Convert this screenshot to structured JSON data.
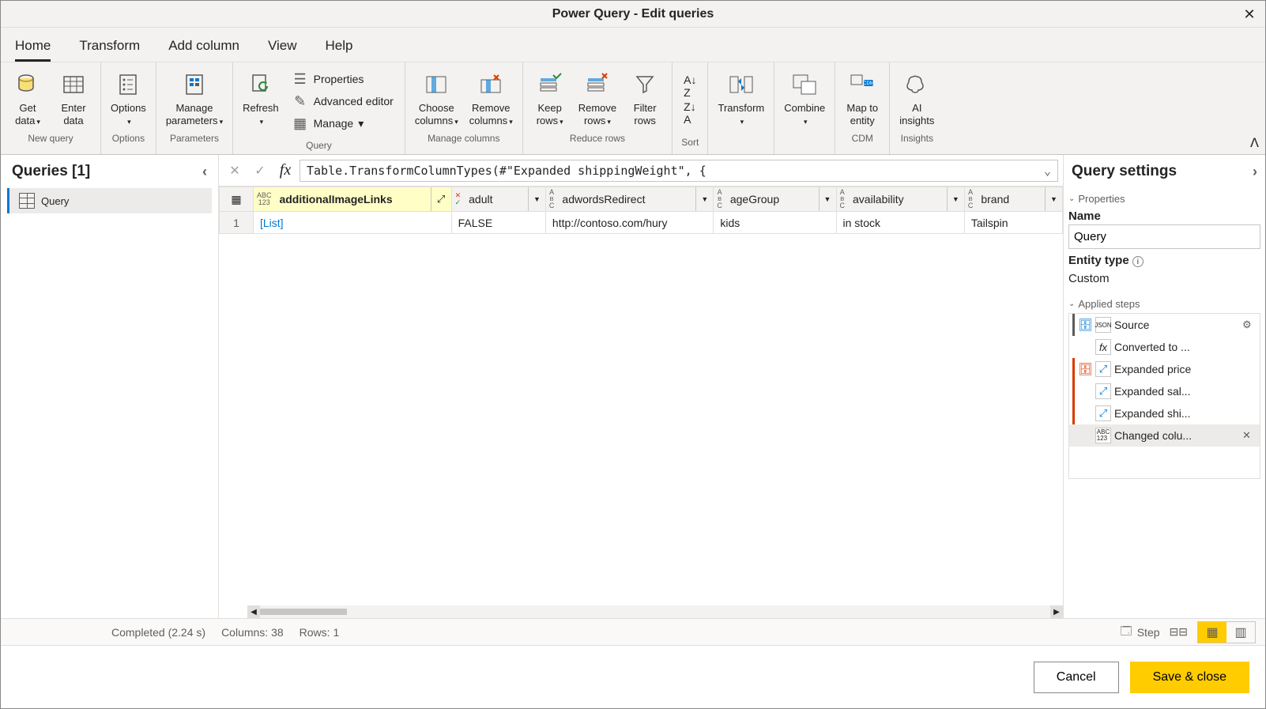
{
  "window": {
    "title": "Power Query - Edit queries"
  },
  "tabs": {
    "home": "Home",
    "transform": "Transform",
    "add_column": "Add column",
    "view": "View",
    "help": "Help"
  },
  "ribbon": {
    "new_query": {
      "get_data": "Get\ndata",
      "enter_data": "Enter\ndata",
      "group": "New query"
    },
    "options": {
      "options": "Options",
      "group": "Options"
    },
    "parameters": {
      "manage_parameters": "Manage\nparameters",
      "group": "Parameters"
    },
    "query": {
      "refresh": "Refresh",
      "properties": "Properties",
      "advanced_editor": "Advanced editor",
      "manage": "Manage",
      "group": "Query"
    },
    "manage_columns": {
      "choose_columns": "Choose\ncolumns",
      "remove_columns": "Remove\ncolumns",
      "group": "Manage columns"
    },
    "reduce_rows": {
      "keep_rows": "Keep\nrows",
      "remove_rows": "Remove\nrows",
      "filter_rows": "Filter\nrows",
      "group": "Reduce rows"
    },
    "sort": {
      "group": "Sort"
    },
    "transform": {
      "transform": "Transform",
      "combine": "Combine"
    },
    "cdm": {
      "map_to_entity": "Map to\nentity",
      "group": "CDM"
    },
    "insights": {
      "ai_insights": "AI\ninsights",
      "group": "Insights"
    }
  },
  "queries": {
    "header": "Queries [1]",
    "items": [
      "Query"
    ]
  },
  "formula": "Table.TransformColumnTypes(#\"Expanded shippingWeight\", {",
  "grid": {
    "columns": [
      {
        "name": "additionalImageLinks",
        "type": "ABC123",
        "selected": true,
        "expand": true
      },
      {
        "name": "adult",
        "type": "X√"
      },
      {
        "name": "adwordsRedirect",
        "type": "ABC"
      },
      {
        "name": "ageGroup",
        "type": "ABC"
      },
      {
        "name": "availability",
        "type": "ABC"
      },
      {
        "name": "brand",
        "type": "ABC"
      }
    ],
    "rows": [
      {
        "num": "1",
        "cells": [
          "[List]",
          "FALSE",
          "http://contoso.com/hury",
          "kids",
          "in stock",
          "Tailspin"
        ]
      }
    ]
  },
  "settings": {
    "header": "Query settings",
    "properties": "Properties",
    "name_label": "Name",
    "name_value": "Query",
    "entity_type_label": "Entity type",
    "entity_type_value": "Custom",
    "applied_steps": "Applied steps",
    "steps": [
      {
        "label": "Source",
        "gear": true
      },
      {
        "label": "Converted to ..."
      },
      {
        "label": "Expanded price"
      },
      {
        "label": "Expanded sal..."
      },
      {
        "label": "Expanded shi..."
      },
      {
        "label": "Changed colu...",
        "selected": true,
        "del": true
      }
    ]
  },
  "status": {
    "completed": "Completed (2.24 s)",
    "columns": "Columns: 38",
    "rows": "Rows: 1",
    "step": "Step"
  },
  "footer": {
    "cancel": "Cancel",
    "save_close": "Save & close"
  }
}
